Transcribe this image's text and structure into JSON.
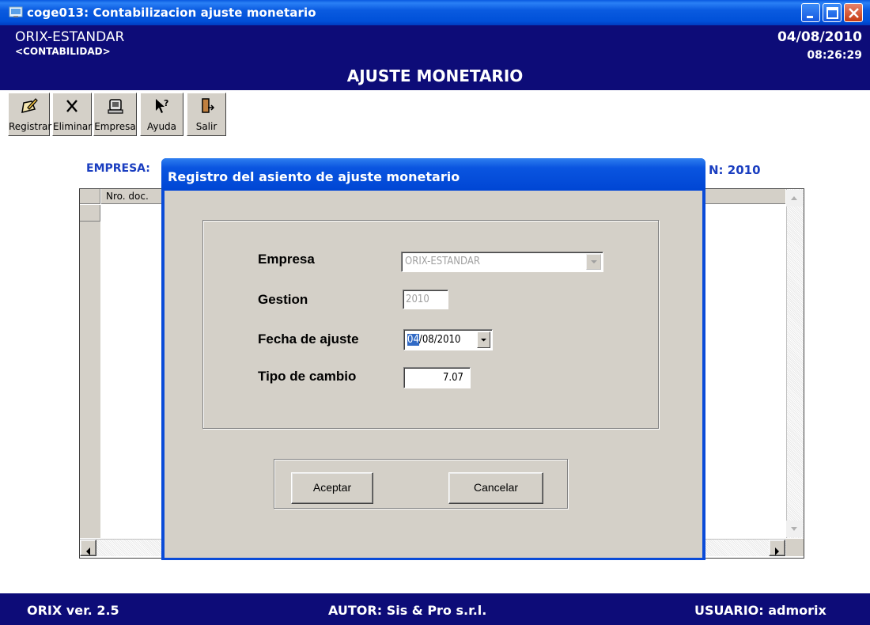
{
  "window": {
    "title": "coge013: Contabilizacion ajuste monetario"
  },
  "header": {
    "company": "ORIX-ESTANDAR",
    "module": "<CONTABILIDAD>",
    "screen_title": "AJUSTE MONETARIO",
    "date": "04/08/2010",
    "time": "08:26:29"
  },
  "toolbar": [
    {
      "label": "Registrar",
      "icon": "register-icon"
    },
    {
      "label": "Eliminar",
      "icon": "delete-icon"
    },
    {
      "label": "Empresa",
      "icon": "company-icon"
    },
    {
      "label": "Ayuda",
      "icon": "help-icon"
    },
    {
      "label": "Salir",
      "icon": "exit-icon"
    }
  ],
  "background": {
    "empresa_label": "EMPRESA:",
    "gestion_fragment": "N: 2010",
    "grid_col_header": "Nro. doc."
  },
  "dialog": {
    "title": "Registro del asiento de ajuste monetario",
    "fields": {
      "empresa": {
        "label": "Empresa",
        "value": "ORIX-ESTANDAR"
      },
      "gestion": {
        "label": "Gestion",
        "value": "2010"
      },
      "fecha": {
        "label": "Fecha de ajuste",
        "selected_part": "04",
        "rest": "/08/2010"
      },
      "tipo_cambio": {
        "label": "Tipo de cambio",
        "value": "7.07"
      }
    },
    "buttons": {
      "accept": "Aceptar",
      "cancel": "Cancelar"
    }
  },
  "status": {
    "version": "ORIX ver. 2.5",
    "author": "AUTOR: Sis & Pro s.r.l.",
    "user": "USUARIO: admorix"
  },
  "colors": {
    "header_bg": "#0d0c78",
    "dialog_title_bg": "#0a4bd8",
    "background_label_blue": "#1a3ec0",
    "selection": "#316ac5"
  }
}
